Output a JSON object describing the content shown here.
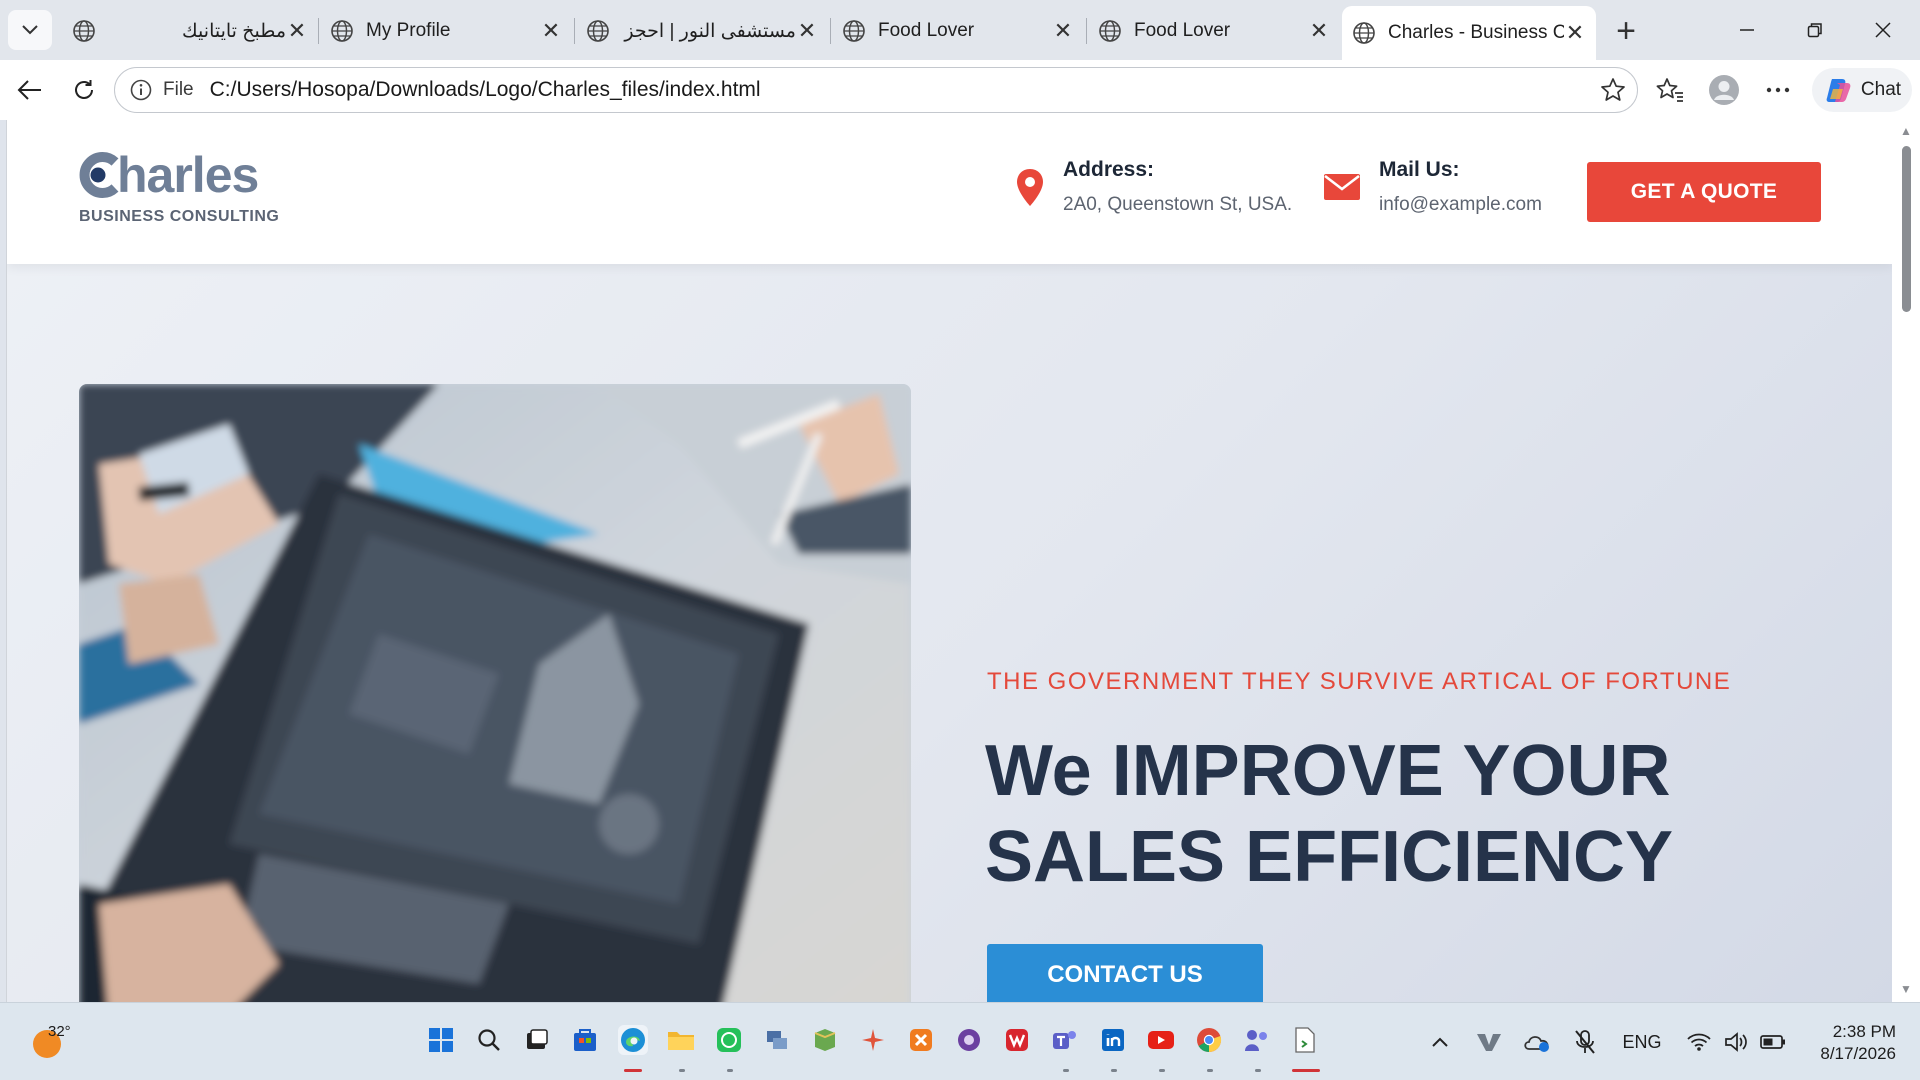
{
  "browser": {
    "tabs": [
      {
        "title": "مطبخ تايتانيك",
        "rtl": true,
        "active": false
      },
      {
        "title": "My Profile",
        "rtl": false,
        "active": false
      },
      {
        "title": "مستشفى النور | احجز ك",
        "rtl": true,
        "active": false
      },
      {
        "title": "Food Lover",
        "rtl": false,
        "active": false
      },
      {
        "title": "Food Lover",
        "rtl": false,
        "active": false
      },
      {
        "title": "Charles - Business Co",
        "rtl": false,
        "active": true
      }
    ],
    "address": {
      "scheme_label": "File",
      "url": "C:/Users/Hosopa/Downloads/Logo/Charles_files/index.html"
    },
    "chat_label": "Chat",
    "accent": "#0b57d0"
  },
  "site": {
    "logo": {
      "word": "harles",
      "tagline": "BUSINESS CONSULTING"
    },
    "address_block": {
      "label": "Address:",
      "value": "2A0, Queenstown St, USA."
    },
    "mail_block": {
      "label": "Mail Us:",
      "value": "info@example.com"
    },
    "quote_button": "GET A QUOTE",
    "hero": {
      "kicker": "THE GOVERNMENT THEY SURVIVE ARTICAL OF FORTUNE",
      "title_line1": "We IMPROVE YOUR",
      "title_line2": "SALES EFFICIENCY",
      "contact_button": "CONTACT US"
    },
    "colors": {
      "primary_red": "#e8473a",
      "primary_blue": "#2b8ed6",
      "heading": "#25334a"
    }
  },
  "taskbar": {
    "weather_temp": "32°",
    "language": "ENG",
    "time": "2:38 PM",
    "date": "8/17/2026"
  }
}
